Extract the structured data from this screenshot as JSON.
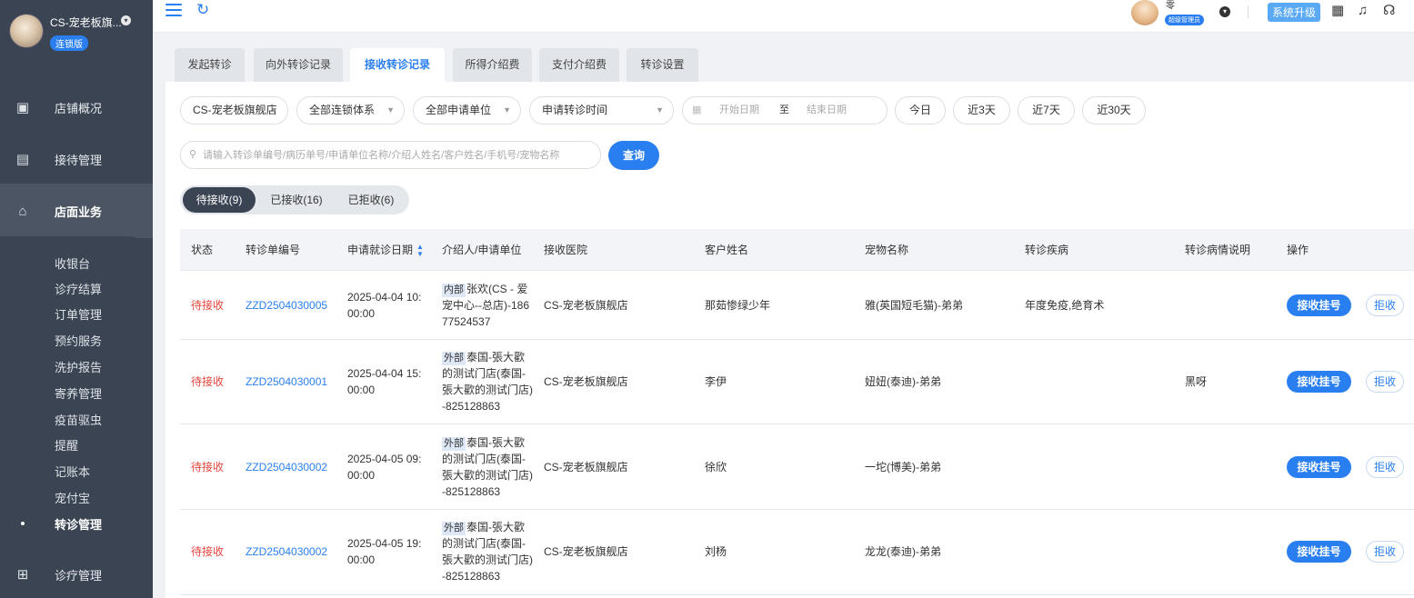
{
  "sidebar": {
    "shop_name": "CS-宠老板旗...",
    "shop_badge": "连锁版",
    "nav": [
      {
        "label": "店铺概况",
        "icon": "dashboard-icon"
      },
      {
        "label": "接待管理",
        "icon": "reception-icon"
      },
      {
        "label": "店面业务",
        "icon": "home-icon"
      },
      {
        "label": "诊疗管理",
        "icon": "medical-kit-icon"
      }
    ],
    "sub_items": [
      "收银台",
      "诊疗结算",
      "订单管理",
      "预约服务",
      "洗护报告",
      "寄养管理",
      "疫苗驱虫",
      "提醒",
      "记账本",
      "宠付宝",
      "转诊管理"
    ]
  },
  "topbar": {
    "username": "零",
    "role_badge": "超级管理员",
    "upgrade_label": "系统升级"
  },
  "tabs": [
    "发起转诊",
    "向外转诊记录",
    "接收转诊记录",
    "所得介绍费",
    "支付介绍费",
    "转诊设置"
  ],
  "filters": {
    "shop": "CS-宠老板旗舰店",
    "chain": "全部连锁体系",
    "applicant": "全部申请单位",
    "time_type": "申请转诊时间",
    "start_placeholder": "开始日期",
    "range_sep": "至",
    "end_placeholder": "结束日期",
    "quick": [
      "今日",
      "近3天",
      "近7天",
      "近30天"
    ]
  },
  "search": {
    "placeholder": "请输入转诊单编号/病历单号/申请单位名称/介绍人姓名/客户姓名/手机号/宠物名称",
    "button": "查询"
  },
  "status_tabs": [
    "待接收(9)",
    "已接收(16)",
    "已拒收(6)"
  ],
  "table": {
    "headers": [
      "状态",
      "转诊单编号",
      "申请就诊日期",
      "介绍人/申请单位",
      "接收医院",
      "客户姓名",
      "宠物名称",
      "转诊疾病",
      "转诊病情说明",
      "操作"
    ],
    "rows": [
      {
        "status": "待接收",
        "code": "ZZD2504030005",
        "date_line1": "2025-04-04 10:",
        "date_line2": "00:00",
        "tag": "内部",
        "ref_line1": "张欢(CS - 爱",
        "ref_line2": "宠中心--总店)-186",
        "ref_line3": "77524537",
        "ref_line4": "",
        "hospital": "CS-宠老板旗舰店",
        "customer": "那茹惨绿少年",
        "pet": "雅(英国短毛猫)-弟弟",
        "disease": "年度免疫,绝育术",
        "note": "",
        "accept": "接收挂号",
        "reject": "拒收"
      },
      {
        "status": "待接收",
        "code": "ZZD2504030001",
        "date_line1": "2025-04-04 15:",
        "date_line2": "00:00",
        "tag": "外部",
        "ref_line1": "泰国-張大歡",
        "ref_line2": "的测试门店(泰国-",
        "ref_line3": "張大歡的测试门店)",
        "ref_line4": "-825128863",
        "hospital": "CS-宠老板旗舰店",
        "customer": "李伊",
        "pet": "妞妞(泰迪)-弟弟",
        "disease": "",
        "note": "黑呀",
        "accept": "接收挂号",
        "reject": "拒收"
      },
      {
        "status": "待接收",
        "code": "ZZD2504030002",
        "date_line1": "2025-04-05 09:",
        "date_line2": "00:00",
        "tag": "外部",
        "ref_line1": "泰国-張大歡",
        "ref_line2": "的测试门店(泰国-",
        "ref_line3": "張大歡的测试门店)",
        "ref_line4": "-825128863",
        "hospital": "CS-宠老板旗舰店",
        "customer": "徐欣",
        "pet": "一坨(博美)-弟弟",
        "disease": "",
        "note": "",
        "accept": "接收挂号",
        "reject": "拒收"
      },
      {
        "status": "待接收",
        "code": "ZZD2504030002",
        "date_line1": "2025-04-05 19:",
        "date_line2": "00:00",
        "tag": "外部",
        "ref_line1": "泰国-張大歡",
        "ref_line2": "的测试门店(泰国-",
        "ref_line3": "張大歡的测试门店)",
        "ref_line4": "-825128863",
        "hospital": "CS-宠老板旗舰店",
        "customer": "刘杨",
        "pet": "龙龙(泰迪)-弟弟",
        "disease": "",
        "note": "",
        "accept": "接收挂号",
        "reject": "拒收"
      }
    ]
  },
  "colors": {
    "accent": "#2a7ff0",
    "sidebar_bg": "#3a4452",
    "status_pending": "#e5463d"
  }
}
